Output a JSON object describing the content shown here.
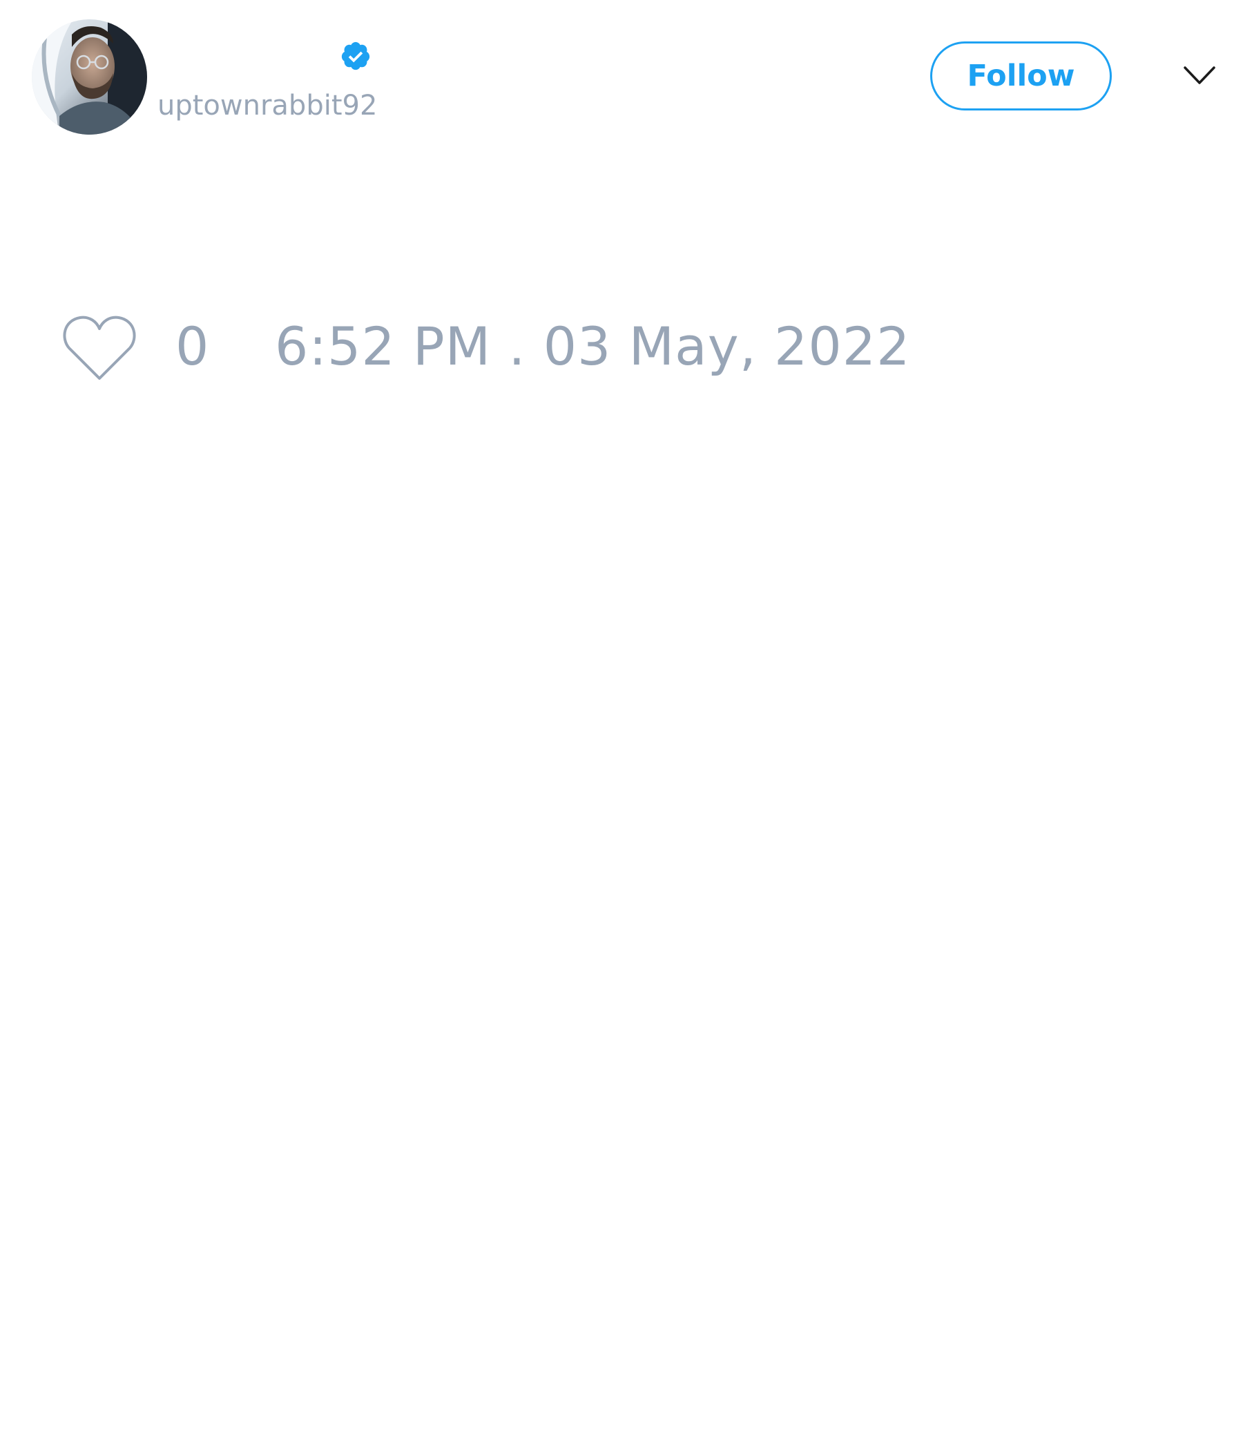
{
  "tweet": {
    "author": {
      "handle": "uptownrabbit92",
      "verified": true,
      "avatar_icon": "profile-photo"
    },
    "follow_label": "Follow",
    "menu_icon": "chevron-down-icon",
    "like_icon": "heart-outline-icon",
    "like_count": "0",
    "timestamp": "6:52 PM . 03 May, 2022"
  },
  "colors": {
    "accent": "#1da1f2",
    "muted_text": "#98a5b6",
    "background": "#ffffff"
  }
}
